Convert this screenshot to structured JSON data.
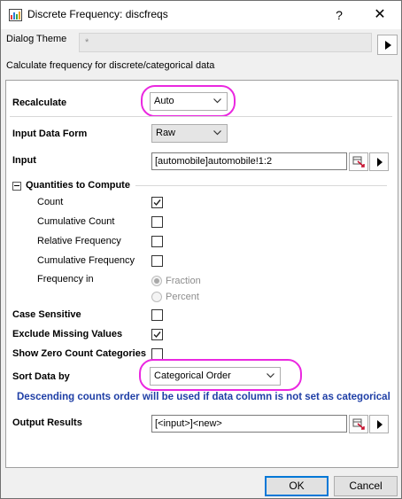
{
  "window": {
    "title": "Discrete Frequency: discfreqs",
    "help_glyph": "?",
    "close_glyph": "✕"
  },
  "theme": {
    "label": "Dialog Theme",
    "value": "*"
  },
  "description": "Calculate frequency for discrete/categorical data",
  "recalculate": {
    "label": "Recalculate",
    "value": "Auto"
  },
  "input_form": {
    "label": "Input Data Form",
    "value": "Raw"
  },
  "input": {
    "label": "Input",
    "value": "[automobile]automobile!1:2"
  },
  "quantities": {
    "label": "Quantities to Compute",
    "count": {
      "label": "Count",
      "checked": true
    },
    "cumulative_count": {
      "label": "Cumulative Count",
      "checked": false
    },
    "relative_frequency": {
      "label": "Relative Frequency",
      "checked": false
    },
    "cumulative_frequency": {
      "label": "Cumulative Frequency",
      "checked": false
    },
    "frequency_in": {
      "label": "Frequency in",
      "options": [
        "Fraction",
        "Percent"
      ],
      "selected": "Fraction"
    }
  },
  "case_sensitive": {
    "label": "Case Sensitive",
    "checked": false
  },
  "exclude_missing": {
    "label": "Exclude Missing Values",
    "checked": true
  },
  "show_zero": {
    "label": "Show Zero Count Categories",
    "checked": false
  },
  "sort": {
    "label": "Sort Data by",
    "value": "Categorical Order"
  },
  "info_text": "Descending counts order will be used if data column is not set as categorical",
  "output": {
    "label": "Output Results",
    "value": "[<input>]<new>"
  },
  "buttons": {
    "ok": "OK",
    "cancel": "Cancel"
  },
  "colors": {
    "highlight": "#ea28e0",
    "info": "#1f3fa6",
    "accent": "#0078d7"
  }
}
